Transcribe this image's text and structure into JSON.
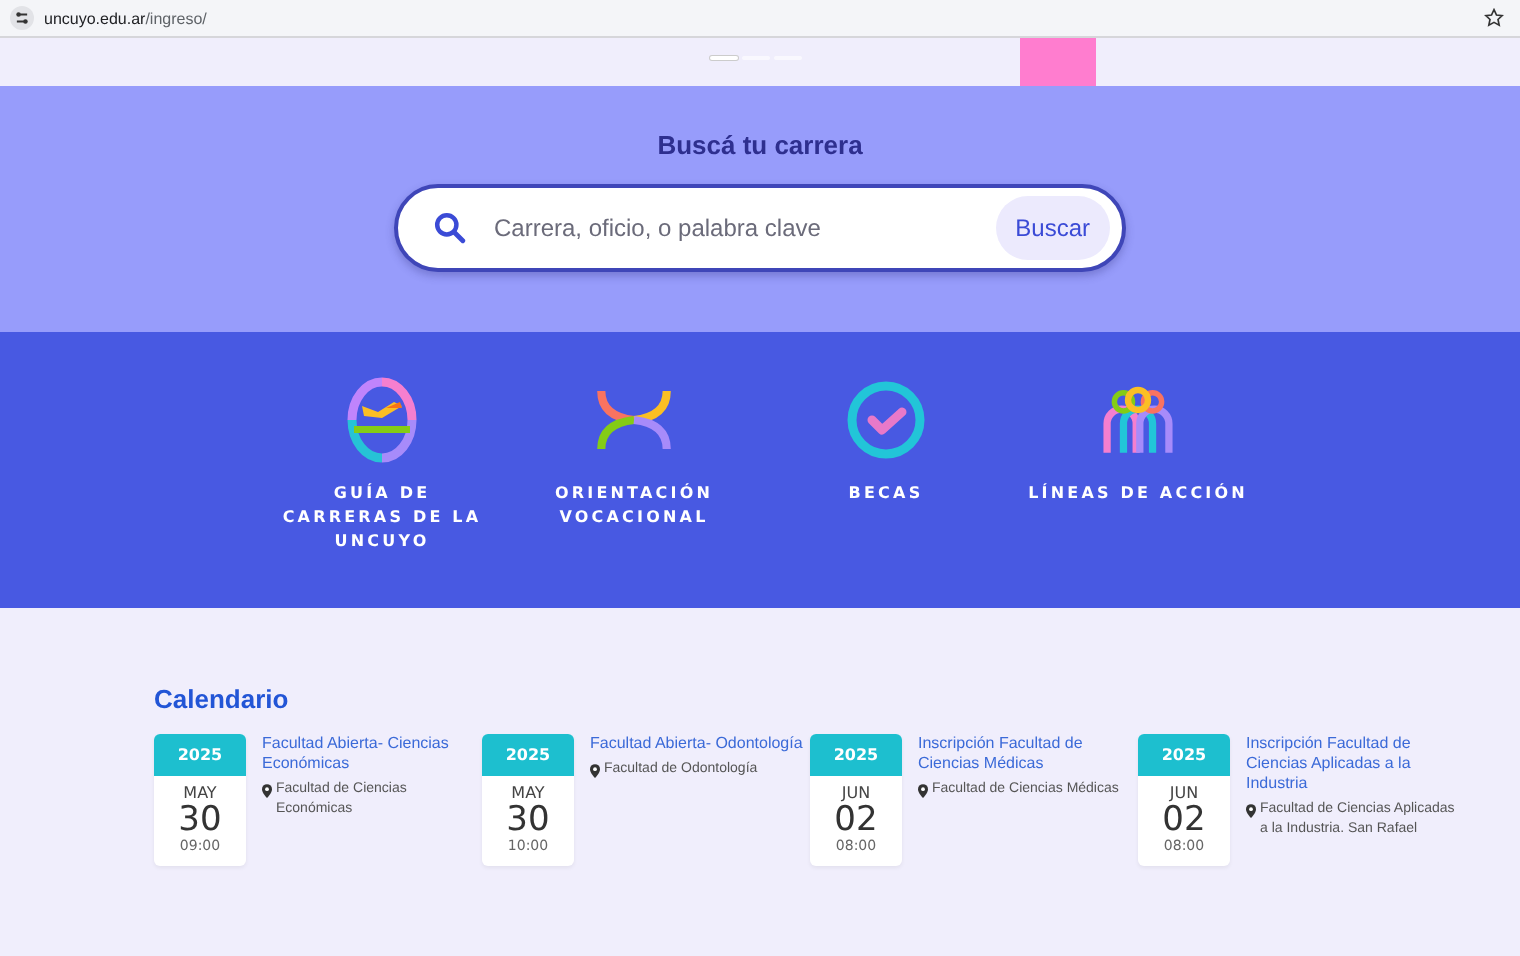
{
  "browser": {
    "url_host": "uncuyo.edu.ar",
    "url_path": "/ingreso/"
  },
  "carousel": {
    "indicators": [
      {
        "selected": true
      },
      {
        "selected": false
      },
      {
        "selected": false
      }
    ]
  },
  "search": {
    "title": "Buscá tu carrera",
    "placeholder": "Carrera, oficio, o palabra clave",
    "button": "Buscar"
  },
  "links": [
    {
      "kind": "guide",
      "label": "GUÍA DE CARRERAS DE LA UNCUYO"
    },
    {
      "kind": "orientation",
      "label": "ORIENTACIÓN VOCACIONAL"
    },
    {
      "kind": "scholarship",
      "label": "BECAS"
    },
    {
      "kind": "lines",
      "label": "LÍNEAS DE ACCIÓN"
    }
  ],
  "calendar": {
    "title": "Calendario",
    "events": [
      {
        "year": "2025",
        "month": "MAY",
        "day": "30",
        "time": "09:00",
        "title": "Facultad Abierta- Ciencias Económicas",
        "place": "Facultad de Ciencias Económicas"
      },
      {
        "year": "2025",
        "month": "MAY",
        "day": "30",
        "time": "10:00",
        "title": "Facultad Abierta- Odontología",
        "place": "Facultad de Odontología"
      },
      {
        "year": "2025",
        "month": "JUN",
        "day": "02",
        "time": "08:00",
        "title": "Inscripción Facultad de Ciencias Médicas",
        "place": "Facultad de Ciencias Médicas"
      },
      {
        "year": "2025",
        "month": "JUN",
        "day": "02",
        "time": "08:00",
        "title": "Inscripción Facultad de Ciencias Aplicadas a la Industria",
        "place": "Facultad de Ciencias Aplicadas a la Industria. San Rafael"
      }
    ]
  }
}
